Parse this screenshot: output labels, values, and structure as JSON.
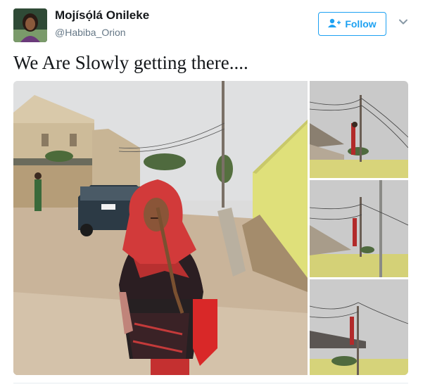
{
  "user": {
    "display_name": "Mojísọ́lá Onileke",
    "handle": "@Habiba_Orion"
  },
  "actions": {
    "follow_label": "Follow"
  },
  "tweet": {
    "text": "We Are Slowly getting there...."
  },
  "icons": {
    "follow": "person-add-icon",
    "more": "chevron-down-icon"
  },
  "colors": {
    "accent": "#1da1f2",
    "secondary_text": "#657786"
  }
}
